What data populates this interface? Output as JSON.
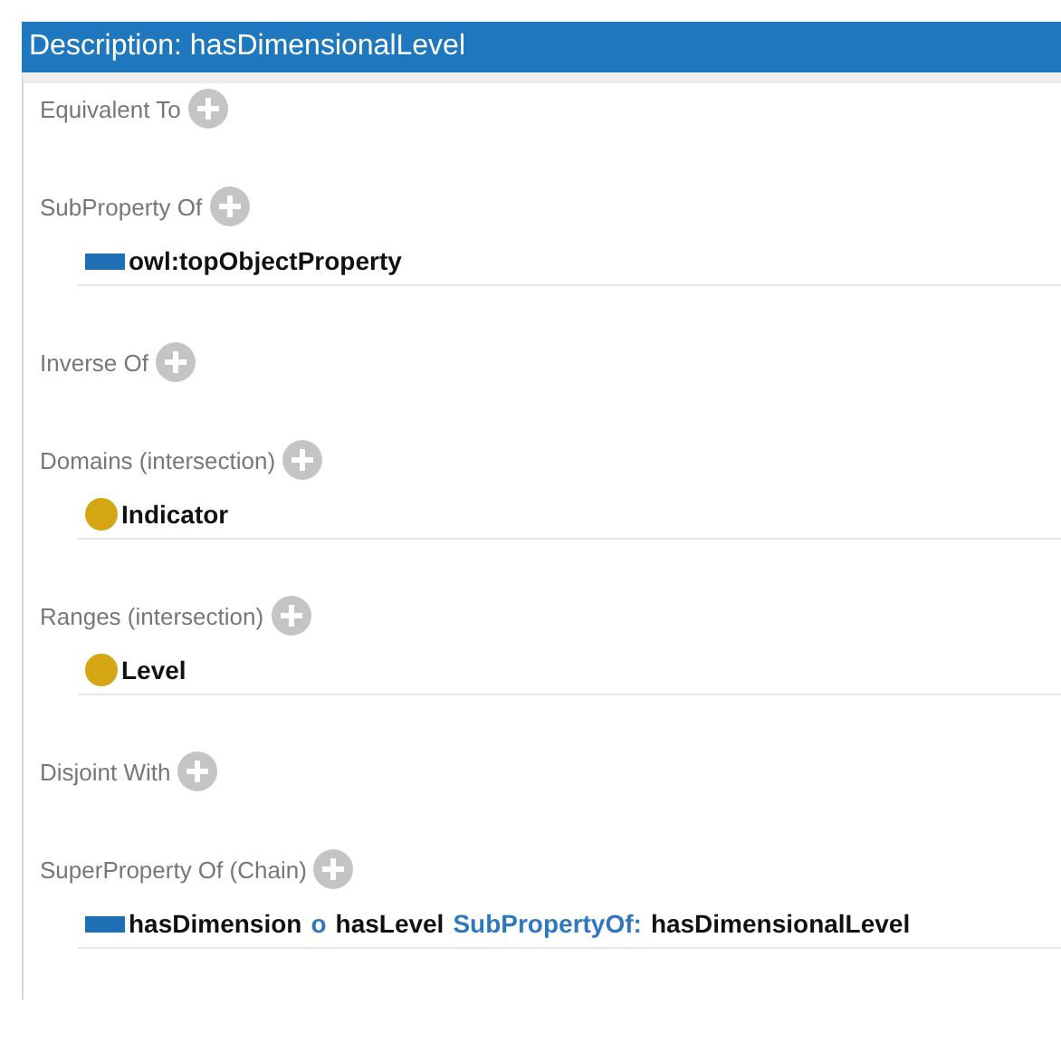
{
  "title": "Description: hasDimensionalLevel",
  "sections": [
    {
      "label": "Equivalent To"
    },
    {
      "label": "SubProperty Of",
      "entries": [
        {
          "kind": "property",
          "tokens": [
            {
              "text": "owl:topObjectProperty",
              "keyword": false
            }
          ]
        }
      ]
    },
    {
      "label": "Inverse Of"
    },
    {
      "label": "Domains (intersection)",
      "entries": [
        {
          "kind": "class",
          "tokens": [
            {
              "text": "Indicator",
              "keyword": false
            }
          ]
        }
      ]
    },
    {
      "label": "Ranges (intersection)",
      "entries": [
        {
          "kind": "class",
          "tokens": [
            {
              "text": "Level",
              "keyword": false
            }
          ]
        }
      ]
    },
    {
      "label": "Disjoint With"
    },
    {
      "label": "SuperProperty Of (Chain)",
      "entries": [
        {
          "kind": "property",
          "tokens": [
            {
              "text": "hasDimension",
              "keyword": false
            },
            {
              "text": "o",
              "keyword": true
            },
            {
              "text": "hasLevel",
              "keyword": false
            },
            {
              "text": "SubPropertyOf:",
              "keyword": true
            },
            {
              "text": "hasDimensionalLevel",
              "keyword": false
            }
          ]
        }
      ]
    }
  ]
}
